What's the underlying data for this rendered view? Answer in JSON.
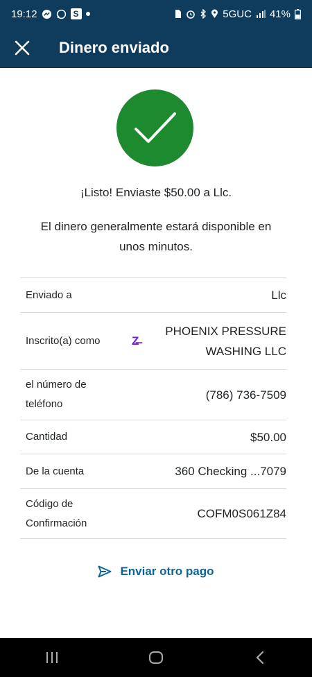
{
  "status_bar": {
    "time": "19:12",
    "left_icons": [
      "messenger-icon",
      "whatsapp-icon",
      "s-app-icon",
      "dot-icon"
    ],
    "s_label": "S",
    "network": "5GUC",
    "battery": "41%"
  },
  "header": {
    "title": "Dinero enviado"
  },
  "confirmation": {
    "headline": "¡Listo! Enviaste $50.00 a Llc.",
    "subtext": "El dinero generalmente estará disponible en unos minutos."
  },
  "details": [
    {
      "label": "Enviado a",
      "value": "Llc"
    },
    {
      "label": "Inscrito(a) como",
      "value": "PHOENIX PRESSURE WASHING LLC",
      "icon": "zelle-icon",
      "icon_glyph": "Z̶"
    },
    {
      "label": "el número de teléfono",
      "value": "(786) 736-7509"
    },
    {
      "label": "Cantidad",
      "value": "$50.00"
    },
    {
      "label": "De la cuenta",
      "value": "360 Checking ...7079"
    },
    {
      "label": "Código de Confirmación",
      "value": "COFM0S061Z84"
    }
  ],
  "actions": {
    "send_again": "Enviar otro pago"
  },
  "colors": {
    "header_bg": "#0f3c5c",
    "success": "#1e8a2f",
    "link": "#0f6496",
    "zelle": "#6d1ed4"
  }
}
